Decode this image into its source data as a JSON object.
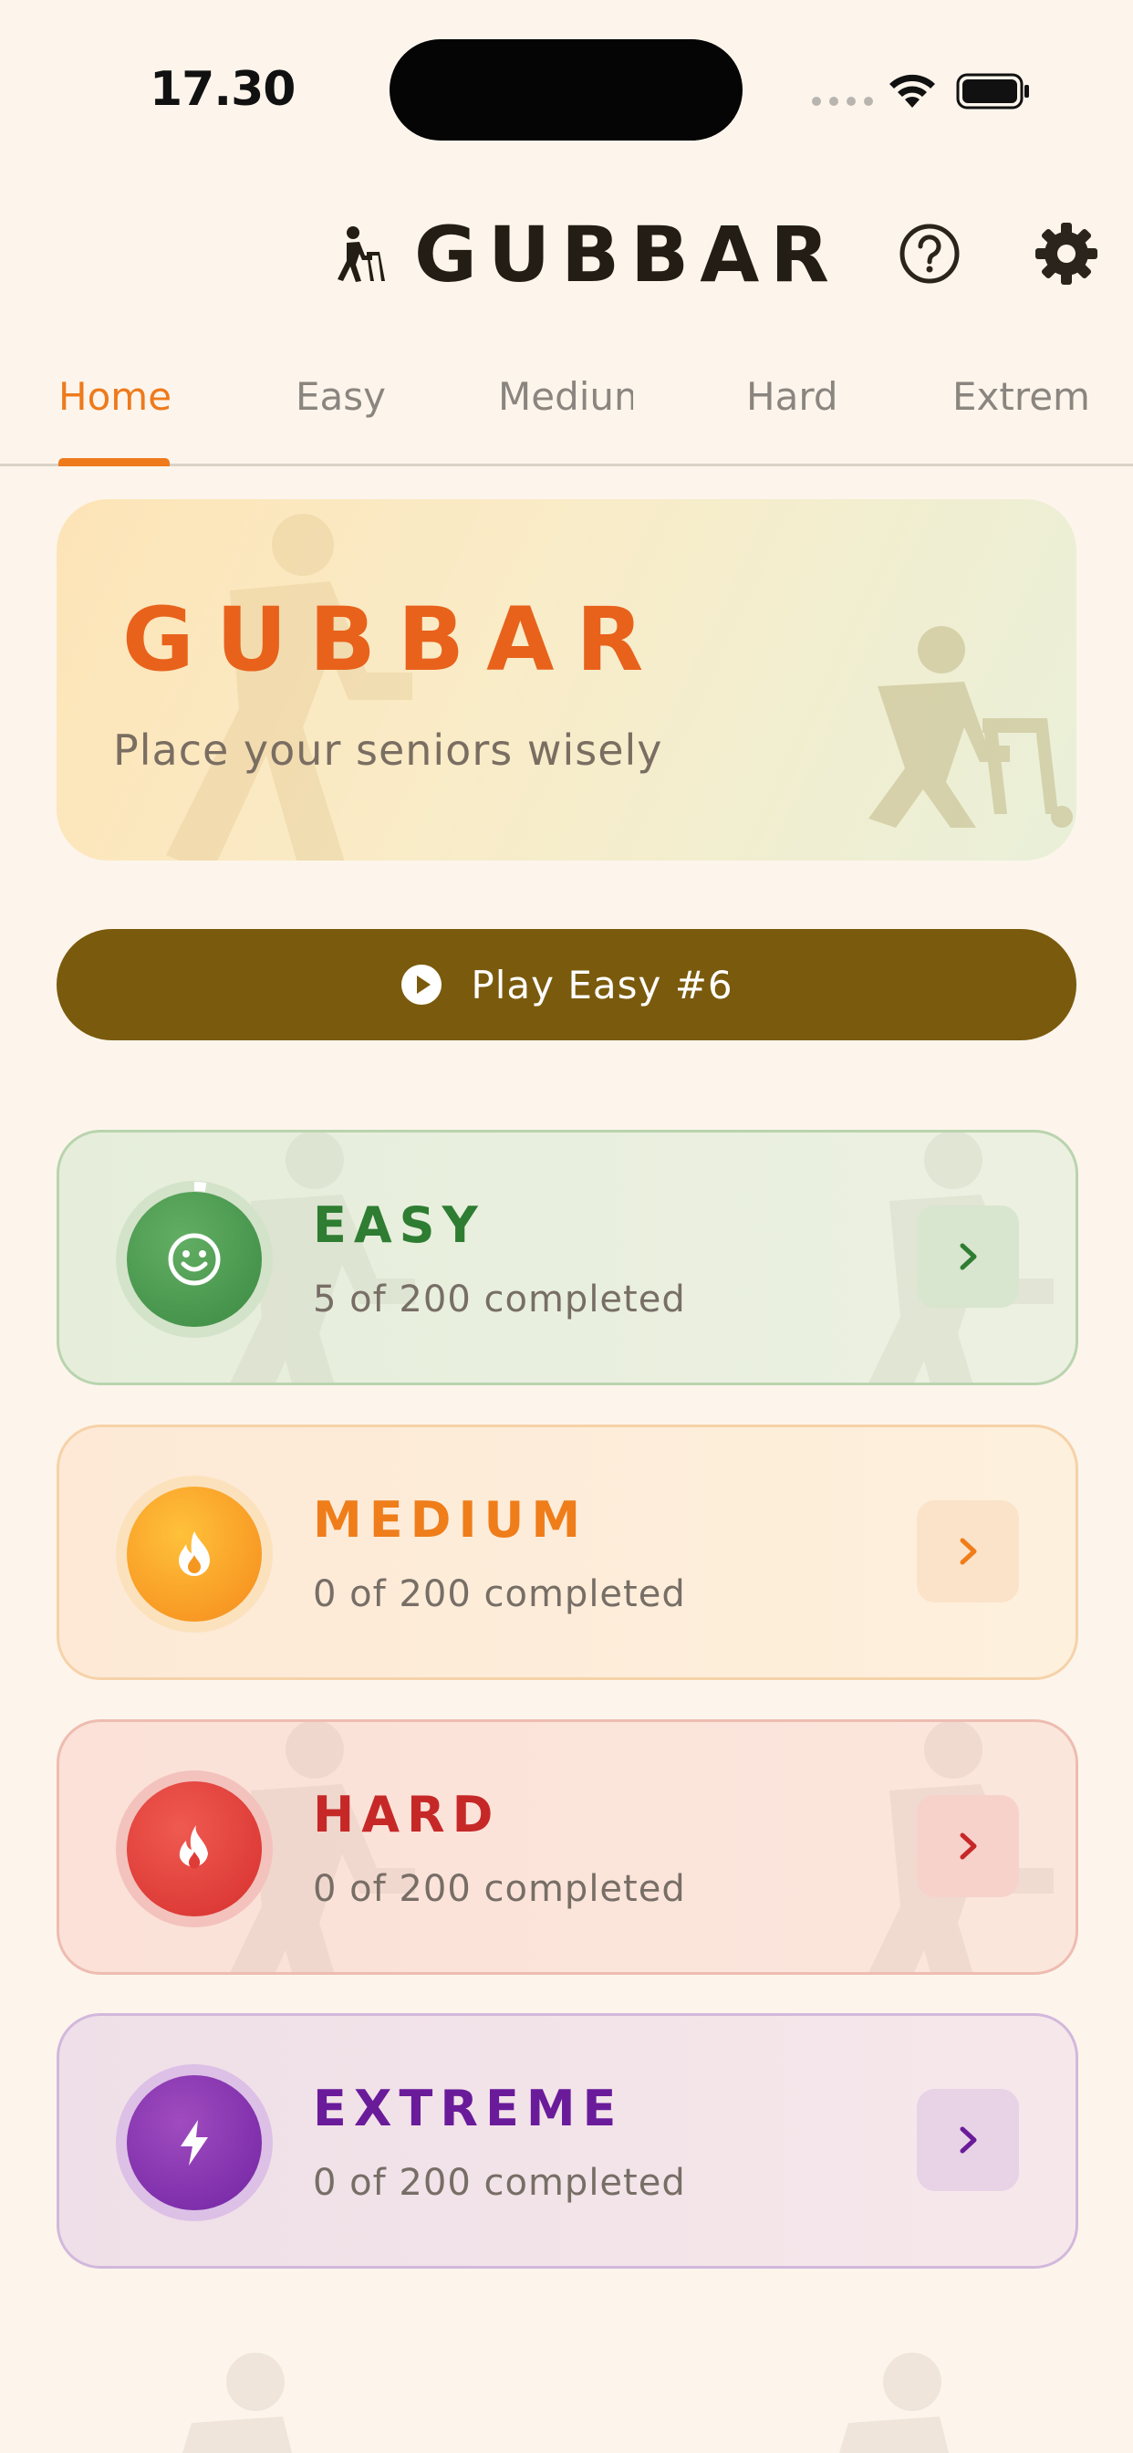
{
  "status_bar": {
    "time": "17.30"
  },
  "header": {
    "title": "GUBBAR",
    "logo_icon": "elderly-person-icon",
    "help_icon": "help-circle-icon",
    "settings_icon": "gear-icon"
  },
  "tabs": [
    {
      "label": "Home",
      "active": true
    },
    {
      "label": "Easy"
    },
    {
      "label": "Medium"
    },
    {
      "label": "Hard"
    },
    {
      "label": "Extreme"
    }
  ],
  "hero": {
    "title": "GUBBAR",
    "subtitle": "Place your seniors wisely"
  },
  "play_button": {
    "label": "Play Easy #6",
    "icon": "play-circle-icon"
  },
  "levels": [
    {
      "name": "EASY",
      "progress_text": "5 of 200 completed",
      "completed": 5,
      "total": 200,
      "icon": "smiley-icon",
      "color": "#2e7d32"
    },
    {
      "name": "MEDIUM",
      "progress_text": "0 of 200 completed",
      "completed": 0,
      "total": 200,
      "icon": "flame-icon",
      "color": "#ef7d1a"
    },
    {
      "name": "HARD",
      "progress_text": "0 of 200 completed",
      "completed": 0,
      "total": 200,
      "icon": "fire-icon",
      "color": "#c62828"
    },
    {
      "name": "EXTREME",
      "progress_text": "0 of 200 completed",
      "completed": 0,
      "total": 200,
      "icon": "lightning-icon",
      "color": "#6a1b9a"
    }
  ],
  "colors": {
    "accent": "#ee7a1c",
    "play_button_bg": "#7a5a0c",
    "background": "#fdf5ec"
  }
}
